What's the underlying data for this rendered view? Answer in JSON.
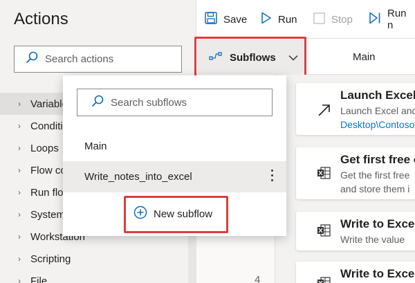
{
  "actions_pane": {
    "title": "Actions",
    "search_placeholder": "Search actions",
    "categories": [
      {
        "label": "Variables"
      },
      {
        "label": "Conditionals"
      },
      {
        "label": "Loops"
      },
      {
        "label": "Flow control"
      },
      {
        "label": "Run flow"
      },
      {
        "label": "System"
      },
      {
        "label": "Workstation"
      },
      {
        "label": "Scripting"
      },
      {
        "label": "File"
      }
    ]
  },
  "toolbar": {
    "save_label": "Save",
    "run_label": "Run",
    "stop_label": "Stop",
    "run_next_label": "Run n"
  },
  "tabs": {
    "subflows_label": "Subflows",
    "main_label": "Main"
  },
  "subflows_dropdown": {
    "search_placeholder": "Search subflows",
    "items": [
      {
        "label": "Main"
      },
      {
        "label": "Write_notes_into_excel"
      }
    ],
    "new_subflow_label": "New subflow"
  },
  "canvas": {
    "line_number": "4",
    "cards": [
      {
        "title": "Launch Excel",
        "desc": "Launch Excel and",
        "link": "Desktop\\Contoso"
      },
      {
        "title": "Get first free c",
        "desc1": "Get the first free",
        "desc2": "and store them i"
      },
      {
        "title": "Write to Excel",
        "desc1": "Write the value"
      },
      {
        "title": "Write to Excel"
      }
    ]
  },
  "colors": {
    "highlight": "#e03c3c",
    "accent": "#0078d4",
    "excel_green": "#217346"
  }
}
